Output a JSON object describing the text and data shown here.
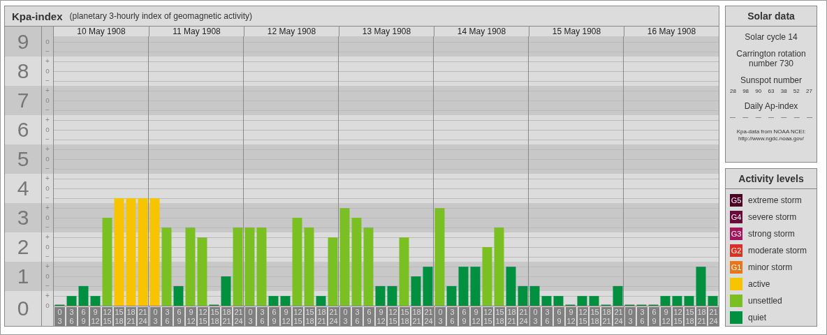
{
  "title": "Kpa-index",
  "subtitle": "(planetary 3-hourly index of geomagnetic activity)",
  "scale_marks": [
    [
      "o",
      "−"
    ],
    [
      "+",
      "o",
      "−"
    ],
    [
      "+",
      "o",
      "−"
    ],
    [
      "+",
      "o",
      "−"
    ],
    [
      "+",
      "o",
      "−"
    ],
    [
      "+",
      "o",
      "−"
    ],
    [
      "+",
      "o",
      "−"
    ],
    [
      "+",
      "o",
      "−"
    ],
    [
      "+",
      "o",
      "−"
    ],
    [
      "+",
      "o"
    ]
  ],
  "days": [
    {
      "date": "10 May 1908",
      "slots": [
        [
          "0",
          "3"
        ],
        [
          "3",
          "6"
        ],
        [
          "6",
          "9"
        ],
        [
          "9",
          "12"
        ],
        [
          "12",
          "15"
        ],
        [
          "15",
          "18"
        ],
        [
          "18",
          "21"
        ],
        [
          "21",
          "24"
        ]
      ]
    },
    {
      "date": "11 May 1908",
      "slots": [
        [
          "0",
          "3"
        ],
        [
          "3",
          "6"
        ],
        [
          "6",
          "9"
        ],
        [
          "9",
          "12"
        ],
        [
          "12",
          "15"
        ],
        [
          "15",
          "18"
        ],
        [
          "18",
          "21"
        ],
        [
          "21",
          "24"
        ]
      ]
    },
    {
      "date": "12 May 1908",
      "slots": [
        [
          "0",
          "3"
        ],
        [
          "3",
          "6"
        ],
        [
          "6",
          "9"
        ],
        [
          "9",
          "12"
        ],
        [
          "12",
          "15"
        ],
        [
          "15",
          "18"
        ],
        [
          "18",
          "21"
        ],
        [
          "21",
          "24"
        ]
      ]
    },
    {
      "date": "13 May 1908",
      "slots": [
        [
          "0",
          "3"
        ],
        [
          "3",
          "6"
        ],
        [
          "6",
          "9"
        ],
        [
          "9",
          "12"
        ],
        [
          "12",
          "15"
        ],
        [
          "15",
          "18"
        ],
        [
          "18",
          "21"
        ],
        [
          "21",
          "24"
        ]
      ]
    },
    {
      "date": "14 May 1908",
      "slots": [
        [
          "0",
          "3"
        ],
        [
          "3",
          "6"
        ],
        [
          "6",
          "9"
        ],
        [
          "9",
          "12"
        ],
        [
          "12",
          "15"
        ],
        [
          "15",
          "18"
        ],
        [
          "18",
          "21"
        ],
        [
          "21",
          "24"
        ]
      ]
    },
    {
      "date": "15 May 1908",
      "slots": [
        [
          "0",
          "3"
        ],
        [
          "3",
          "6"
        ],
        [
          "6",
          "9"
        ],
        [
          "9",
          "12"
        ],
        [
          "12",
          "15"
        ],
        [
          "15",
          "18"
        ],
        [
          "18",
          "21"
        ],
        [
          "21",
          "24"
        ]
      ]
    },
    {
      "date": "16 May 1908",
      "slots": [
        [
          "0",
          "3"
        ],
        [
          "3",
          "6"
        ],
        [
          "6",
          "9"
        ],
        [
          "9",
          "12"
        ],
        [
          "12",
          "15"
        ],
        [
          "15",
          "18"
        ],
        [
          "18",
          "21"
        ],
        [
          "21",
          "24"
        ]
      ]
    }
  ],
  "chart_data": {
    "type": "bar",
    "ylim": [
      0,
      9
    ],
    "grid": true,
    "yticks": [
      {
        "value": 9,
        "label": "9"
      },
      {
        "value": 8,
        "label": "8"
      },
      {
        "value": 7,
        "label": "7"
      },
      {
        "value": 6,
        "label": "6"
      },
      {
        "value": 5,
        "label": "5"
      },
      {
        "value": 4,
        "label": "4"
      },
      {
        "value": 3,
        "label": "3"
      },
      {
        "value": 2,
        "label": "2"
      },
      {
        "value": 1,
        "label": "1"
      },
      {
        "value": 0,
        "label": "0"
      }
    ],
    "values": [
      0,
      0.33,
      0.67,
      0.33,
      3,
      3.67,
      3.67,
      3.67,
      3.67,
      2.67,
      0.67,
      2.67,
      2.33,
      0,
      1,
      2.67,
      2.67,
      2.67,
      0.33,
      0.33,
      3,
      2.67,
      0.33,
      2.33,
      3.33,
      3,
      2.67,
      0.67,
      0.67,
      2.33,
      1,
      1.33,
      3.33,
      0.67,
      1.33,
      1.33,
      2,
      2.67,
      1.33,
      0.67,
      0.67,
      0.33,
      0.33,
      0,
      0.33,
      0.33,
      0,
      0.67,
      0,
      0,
      0,
      0.33,
      0.33,
      0.33,
      1.33,
      0.33
    ]
  },
  "solar": {
    "title": "Solar data",
    "cycle": "Solar cycle 14",
    "rotation": "Carrington rotation number 730",
    "sunspot_label": "Sunspot number",
    "sunspots": [
      "28",
      "98",
      "90",
      "63",
      "38",
      "52",
      "27"
    ],
    "ap_label": "Daily Ap-index",
    "ap": [
      "—",
      "—",
      "—",
      "—",
      "—",
      "—",
      "—"
    ],
    "source": "Kpa-data from NOAA NCEI:",
    "source_url": "http://www.ngdc.noaa.gov/"
  },
  "activity": {
    "title": "Activity levels",
    "levels": [
      {
        "badge": "G5",
        "label": "extreme storm",
        "color": "#4d0023"
      },
      {
        "badge": "G4",
        "label": "severe storm",
        "color": "#6b0a3a"
      },
      {
        "badge": "G3",
        "label": "strong storm",
        "color": "#a3155a"
      },
      {
        "badge": "G2",
        "label": "moderate storm",
        "color": "#dc3020"
      },
      {
        "badge": "G1",
        "label": "minor storm",
        "color": "#e8761a"
      },
      {
        "label": "active",
        "color": "#f8c400"
      },
      {
        "label": "unsettled",
        "color": "#7bc023"
      },
      {
        "label": "quiet",
        "color": "#009040"
      }
    ]
  }
}
